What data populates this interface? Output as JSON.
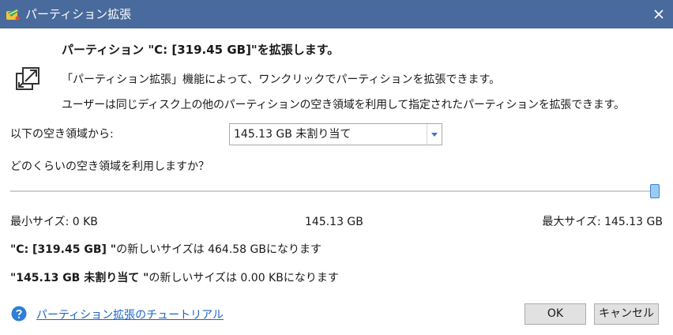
{
  "window": {
    "title": "パーティション拡張",
    "close_icon": "close-icon"
  },
  "header": {
    "icon": "expand-arrows-icon",
    "heading": "パーティション \"C: [319.45 GB]\"を拡張します。",
    "description1": "「パーティション拡張」機能によって、ワンクリックでパーティションを拡張できます。",
    "description2": "ユーザーは同じディスク上の他のパーティションの空き領域を利用して指定されたパーティションを拡張できます。"
  },
  "source": {
    "label": "以下の空き領域から:",
    "selected": "145.13 GB  未割り当て"
  },
  "question": "どのくらいの空き領域を利用しますか？",
  "slider": {
    "value_fraction": 1.0
  },
  "sizes": {
    "min": "最小サイズ: 0 KB",
    "current": "145.13 GB",
    "max": "最大サイズ: 145.13 GB"
  },
  "results": [
    {
      "name_bold": "\"C: [319.45 GB] \"",
      "text": "の新しいサイズは 464.58 GBになります"
    },
    {
      "name_bold": "\"145.13 GB 未割り当て \"",
      "text": "の新しいサイズは 0.00 KBになります"
    }
  ],
  "footer": {
    "help_link": "パーティション拡張のチュートリアル",
    "ok": "OK",
    "cancel": "キャンセル"
  },
  "colors": {
    "titlebar": "#496a9c",
    "link": "#1a66c4",
    "help_icon": "#2f7fd6",
    "slider_thumb": "#9ccaf2"
  }
}
